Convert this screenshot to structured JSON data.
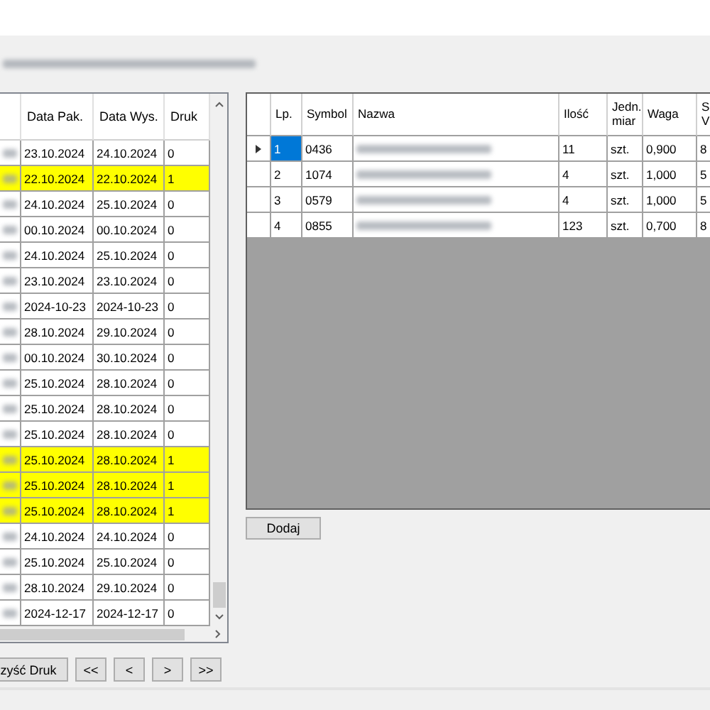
{
  "orders": {
    "columns": [
      "Data Pak.",
      "Data Wys.",
      "Druk"
    ],
    "rows": [
      {
        "data_pak": "23.10.2024",
        "data_wys": "24.10.2024",
        "druk": "0",
        "highlighted": false
      },
      {
        "data_pak": "22.10.2024",
        "data_wys": "22.10.2024",
        "druk": "1",
        "highlighted": true
      },
      {
        "data_pak": "24.10.2024",
        "data_wys": "25.10.2024",
        "druk": "0",
        "highlighted": false
      },
      {
        "data_pak": "00.10.2024",
        "data_wys": "00.10.2024",
        "druk": "0",
        "highlighted": false
      },
      {
        "data_pak": "24.10.2024",
        "data_wys": "25.10.2024",
        "druk": "0",
        "highlighted": false
      },
      {
        "data_pak": "23.10.2024",
        "data_wys": "23.10.2024",
        "druk": "0",
        "highlighted": false
      },
      {
        "data_pak": "2024-10-23",
        "data_wys": "2024-10-23",
        "druk": "0",
        "highlighted": false
      },
      {
        "data_pak": "28.10.2024",
        "data_wys": "29.10.2024",
        "druk": "0",
        "highlighted": false
      },
      {
        "data_pak": "00.10.2024",
        "data_wys": "30.10.2024",
        "druk": "0",
        "highlighted": false
      },
      {
        "data_pak": "25.10.2024",
        "data_wys": "28.10.2024",
        "druk": "0",
        "highlighted": false
      },
      {
        "data_pak": "25.10.2024",
        "data_wys": "28.10.2024",
        "druk": "0",
        "highlighted": false
      },
      {
        "data_pak": "25.10.2024",
        "data_wys": "28.10.2024",
        "druk": "0",
        "highlighted": false
      },
      {
        "data_pak": "25.10.2024",
        "data_wys": "28.10.2024",
        "druk": "1",
        "highlighted": true
      },
      {
        "data_pak": "25.10.2024",
        "data_wys": "28.10.2024",
        "druk": "1",
        "highlighted": true
      },
      {
        "data_pak": "25.10.2024",
        "data_wys": "28.10.2024",
        "druk": "1",
        "highlighted": true
      },
      {
        "data_pak": "24.10.2024",
        "data_wys": "24.10.2024",
        "druk": "0",
        "highlighted": false
      },
      {
        "data_pak": "25.10.2024",
        "data_wys": "25.10.2024",
        "druk": "0",
        "highlighted": false
      },
      {
        "data_pak": "28.10.2024",
        "data_wys": "29.10.2024",
        "druk": "0",
        "highlighted": false
      },
      {
        "data_pak": "2024-12-17",
        "data_wys": "2024-12-17",
        "druk": "0",
        "highlighted": false
      }
    ]
  },
  "nav_buttons": [
    "zyść Druk",
    "<<",
    "<",
    ">",
    ">>"
  ],
  "items": {
    "columns": [
      "Lp.",
      "Symbol",
      "Nazwa",
      "Ilość",
      "Jedn. miar",
      "Waga",
      "S V"
    ],
    "rows": [
      {
        "lp": "1",
        "symbol": "0436",
        "ilosc": "11",
        "jedn": "szt.",
        "waga": "0,900",
        "column_8": "8",
        "selected": true
      },
      {
        "lp": "2",
        "symbol": "1074",
        "ilosc": "4",
        "jedn": "szt.",
        "waga": "1,000",
        "column_8": "5",
        "selected": false
      },
      {
        "lp": "3",
        "symbol": "0579",
        "ilosc": "4",
        "jedn": "szt.",
        "waga": "1,000",
        "column_8": "5",
        "selected": false
      },
      {
        "lp": "4",
        "symbol": "0855",
        "ilosc": "123",
        "jedn": "szt.",
        "waga": "0,700",
        "column_8": "8",
        "selected": false
      }
    ]
  },
  "add_button": "Dodaj"
}
